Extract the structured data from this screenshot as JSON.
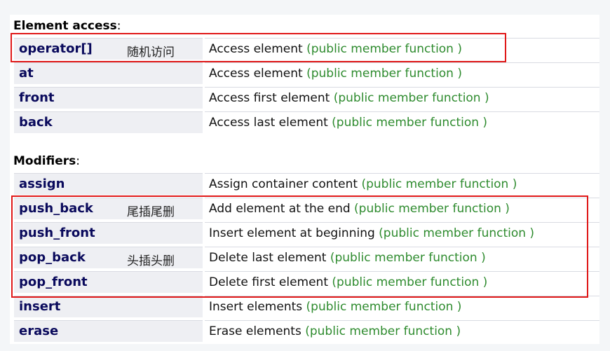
{
  "sections": [
    {
      "title": "Element access",
      "rows": [
        {
          "name": "operator[]",
          "note": "随机访问",
          "desc": "Access element ",
          "tag": "(public member function )"
        },
        {
          "name": "at",
          "note": "",
          "desc": "Access element ",
          "tag": "(public member function )"
        },
        {
          "name": "front",
          "note": "",
          "desc": "Access first element ",
          "tag": "(public member function )"
        },
        {
          "name": "back",
          "note": "",
          "desc": "Access last element ",
          "tag": "(public member function )"
        }
      ]
    },
    {
      "title": "Modifiers",
      "rows": [
        {
          "name": "assign",
          "note": "",
          "desc": "Assign container content ",
          "tag": "(public member function )"
        },
        {
          "name": "push_back",
          "note": "尾插尾删",
          "desc": "Add element at the end ",
          "tag": "(public member function )"
        },
        {
          "name": "push_front",
          "note": "",
          "desc": "Insert element at beginning ",
          "tag": "(public member function )"
        },
        {
          "name": "pop_back",
          "note": "头插头删",
          "desc": "Delete last element ",
          "tag": "(public member function )"
        },
        {
          "name": "pop_front",
          "note": "",
          "desc": "Delete first element ",
          "tag": "(public member function )"
        },
        {
          "name": "insert",
          "note": "",
          "desc": "Insert elements ",
          "tag": "(public member function )"
        },
        {
          "name": "erase",
          "note": "",
          "desc": "Erase elements ",
          "tag": "(public member function )"
        }
      ]
    }
  ],
  "colors": {
    "function_name": "#0a0a5c",
    "member_tag": "#2e8b2e",
    "highlight_box": "#e01818",
    "name_cell_bg": "#eeeff3"
  }
}
